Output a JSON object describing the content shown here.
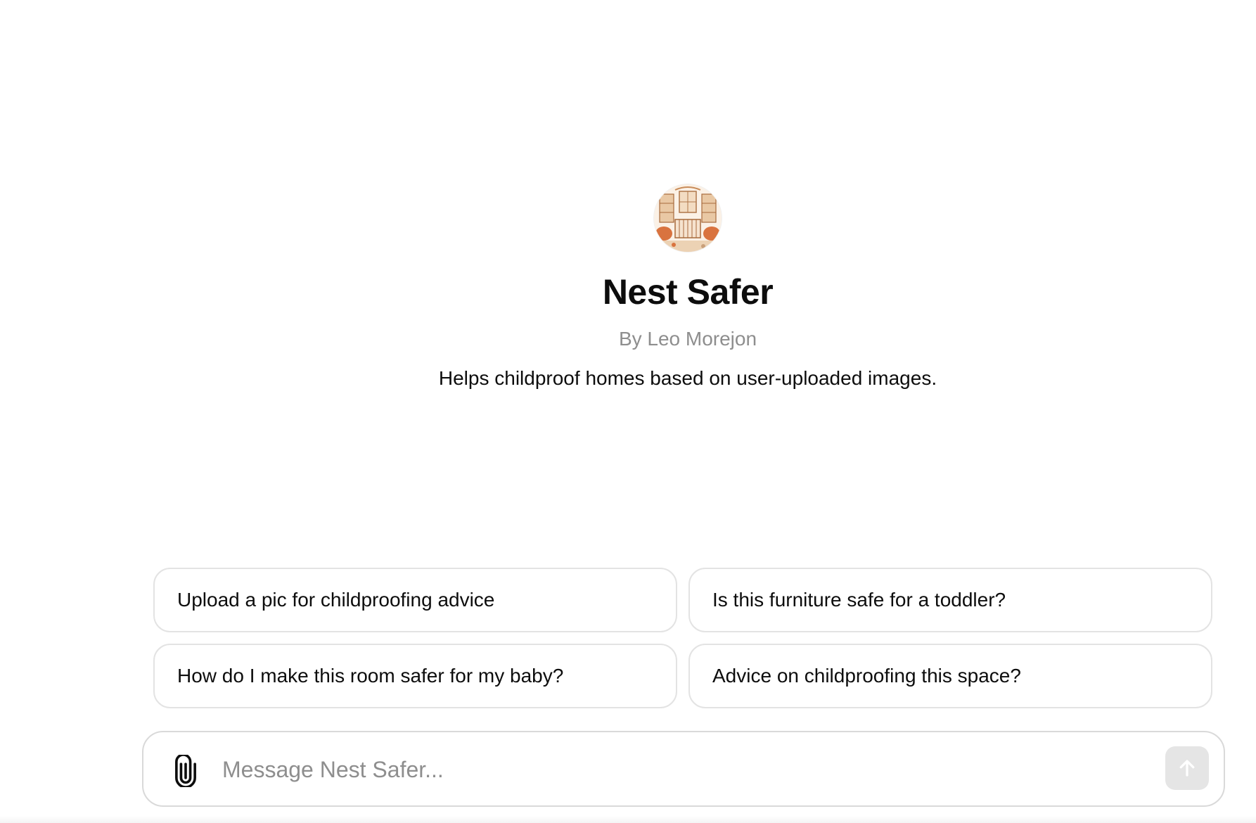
{
  "gpt": {
    "name": "Nest Safer",
    "byline": "By Leo Morejon",
    "description": "Helps childproof homes based on user-uploaded images.",
    "avatar_icon": "nursery-room-illustration-icon"
  },
  "suggestions": [
    {
      "label": "Upload a pic for childproofing advice"
    },
    {
      "label": "Is this furniture safe for a toddler?"
    },
    {
      "label": "How do I make this room safer for my baby?"
    },
    {
      "label": "Advice on childproofing this space?"
    }
  ],
  "composer": {
    "placeholder": "Message Nest Safer...",
    "value": "",
    "attach_icon": "paperclip-icon",
    "send_icon": "arrow-up-icon"
  },
  "footer": {
    "disclaimer": ""
  },
  "colors": {
    "text": "#0d0d0d",
    "muted": "#8e8e8e",
    "border": "#e3e3e3",
    "send_disabled": "#e5e5e5"
  }
}
